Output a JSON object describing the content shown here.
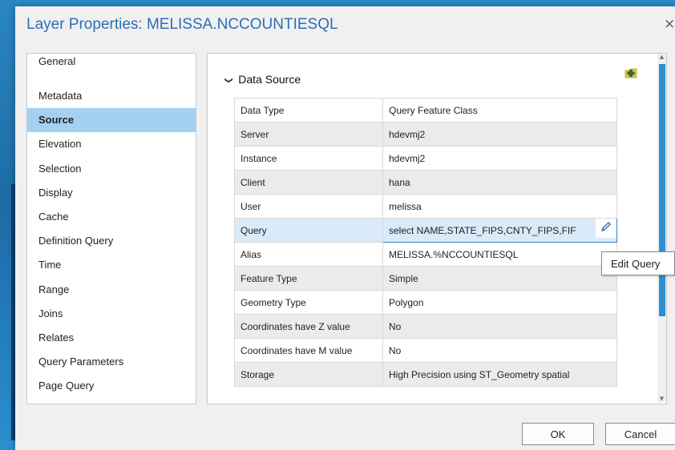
{
  "dialog": {
    "title": "Layer Properties: MELISSA.NCCOUNTIESQL",
    "close_glyph": "×"
  },
  "nav": {
    "items": [
      {
        "label": "General",
        "selected": false
      },
      {
        "label": "Metadata",
        "selected": false
      },
      {
        "label": "Source",
        "selected": true
      },
      {
        "label": "Elevation",
        "selected": false
      },
      {
        "label": "Selection",
        "selected": false
      },
      {
        "label": "Display",
        "selected": false
      },
      {
        "label": "Cache",
        "selected": false
      },
      {
        "label": "Definition Query",
        "selected": false
      },
      {
        "label": "Time",
        "selected": false
      },
      {
        "label": "Range",
        "selected": false
      },
      {
        "label": "Joins",
        "selected": false
      },
      {
        "label": "Relates",
        "selected": false
      },
      {
        "label": "Query Parameters",
        "selected": false
      },
      {
        "label": "Page Query",
        "selected": false
      }
    ]
  },
  "section": {
    "title": "Data Source",
    "chevron": "❯",
    "add_icon": "add-data-icon",
    "rows": [
      {
        "key": "Data Type",
        "value": "Query Feature Class"
      },
      {
        "key": "Server",
        "value": "hdevmj2"
      },
      {
        "key": "Instance",
        "value": "hdevmj2"
      },
      {
        "key": "Client",
        "value": "hana"
      },
      {
        "key": "User",
        "value": "melissa"
      },
      {
        "key": "Query",
        "value": "select NAME,STATE_FIPS,CNTY_FIPS,FIF"
      },
      {
        "key": "Alias",
        "value": "MELISSA.%NCCOUNTIESQL"
      },
      {
        "key": "Feature Type",
        "value": "Simple"
      },
      {
        "key": "Geometry Type",
        "value": "Polygon"
      },
      {
        "key": "Coordinates have Z value",
        "value": "No"
      },
      {
        "key": "Coordinates have M value",
        "value": "No"
      },
      {
        "key": "Storage",
        "value": "High Precision using ST_Geometry spatial"
      }
    ]
  },
  "tooltip": {
    "text": "Edit Query"
  },
  "buttons": {
    "ok": "OK",
    "cancel": "Cancel"
  },
  "colors": {
    "accent": "#2c6fb3",
    "selection": "#a4d0f2",
    "scrollbar": "#2b8fd4"
  }
}
